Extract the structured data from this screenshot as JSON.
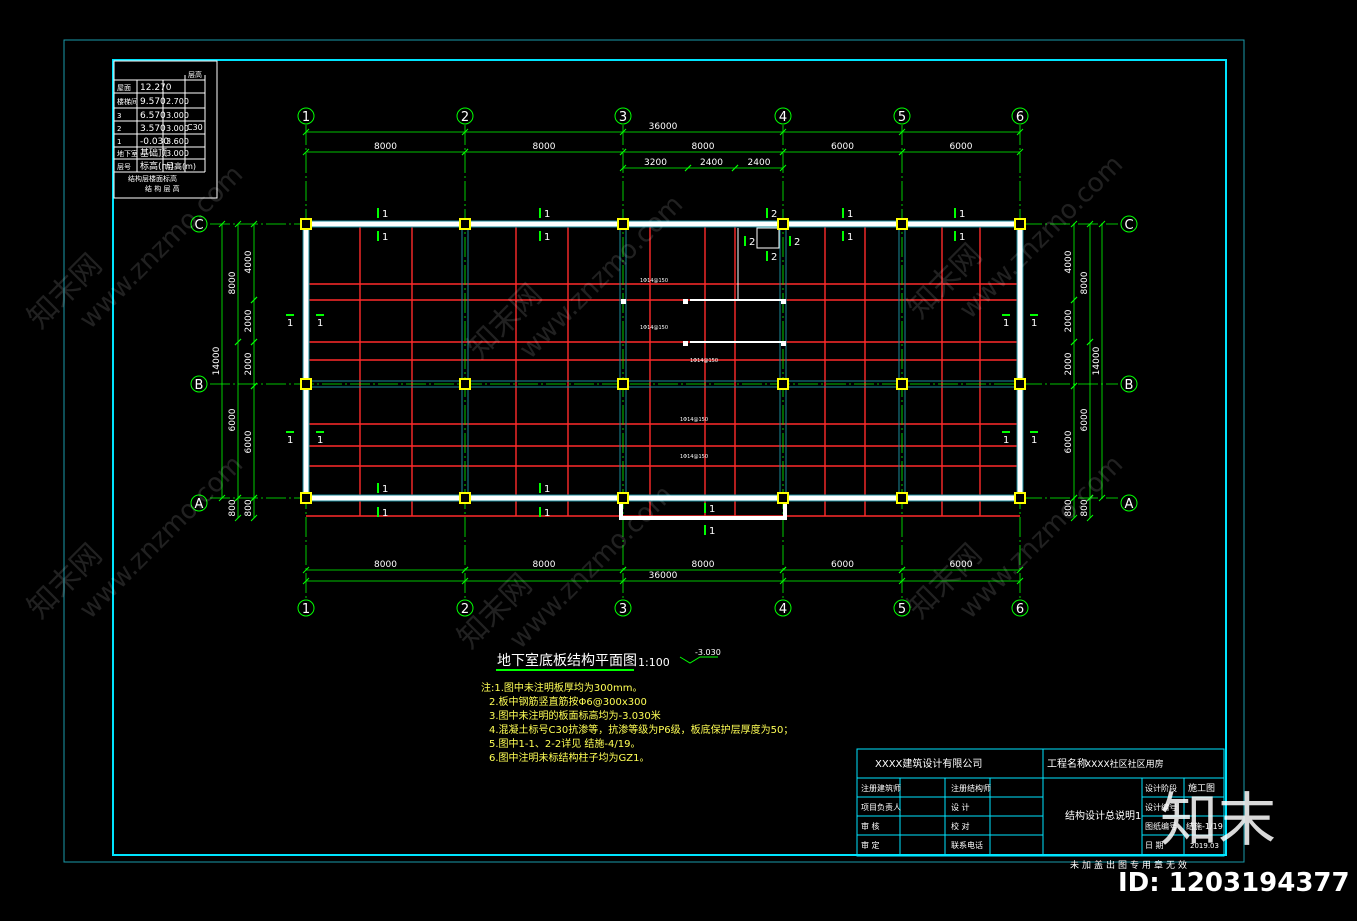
{
  "drawing": {
    "title": "地下室底板结构平面图",
    "scale": "1:100",
    "elevation": "-3.030",
    "axes_numbers": [
      "1",
      "2",
      "3",
      "4",
      "5",
      "6"
    ],
    "axes_letters": [
      "A",
      "B",
      "C"
    ],
    "spans_x_top": [
      "8000",
      "8000",
      "8000",
      "6000",
      "6000"
    ],
    "total_x": "36000",
    "sub_dims": [
      "3200",
      "2400",
      "2400"
    ],
    "spans_y_left_outer": [
      "8000",
      "6000"
    ],
    "spans_y_left_inner": [
      "4000",
      "2000",
      "2000",
      "6000"
    ],
    "total_y": "14000",
    "edge_dim": "800",
    "section_marks": [
      "1",
      "2",
      "1"
    ],
    "rebar_labels": [
      "1Φ14@150",
      "1Φ14@150",
      "1Φ14@150",
      "1Φ14@150",
      "1Φ14@150"
    ]
  },
  "level_table": {
    "header": [
      "",
      "",
      "层高"
    ],
    "rows": [
      [
        "屋面",
        "12.270",
        ""
      ],
      [
        "楼梯间",
        "9.570",
        "2.700"
      ],
      [
        "3",
        "6.570",
        "3.000"
      ],
      [
        "2",
        "3.570",
        "3.000"
      ],
      [
        "1",
        "-0.030",
        "3.600"
      ],
      [
        "地下室",
        "基础顶",
        "3.000"
      ],
      [
        "层号",
        "标高(m)",
        "层高(m)"
      ]
    ],
    "side": "C30",
    "caption1": "结构层楼面标高",
    "caption2": "结 构 层 高"
  },
  "notes": [
    "注:1.图中未注明板厚均为300mm。",
    "2.板中钢筋竖直筋按Φ6@300x300",
    "3.图中未注明的板面标高均为-3.030米",
    "4.混凝土标号C30抗渗等，抗渗等级为P6级，板底保护层厚度为50；",
    "5.图中1-1、2-2详见 结施-4/19。",
    "6.图中注明未标结构柱子均为GZ1。"
  ],
  "title_block": {
    "company": "XXXX建筑设计有限公司",
    "project_label": "工程名称",
    "project_name": "XXXX社区社区用房",
    "drawing_name": "结构设计总说明1",
    "stage_label": "设计阶段",
    "stage": "施工图",
    "design_no_label": "设计编号",
    "sheet_no_label": "图纸编号",
    "sheet_no": "结施-1/19",
    "date_label": "日 期",
    "date": "2019.03",
    "left_rows": [
      "注册建筑师",
      "项目负责人",
      "审 核",
      "审 定"
    ],
    "mid_rows": [
      "注册结构师",
      "设 计",
      "校 对",
      "联系电话"
    ],
    "footer": "未加盖出图专用章无效"
  },
  "watermark": {
    "site": "www.znzmo.com",
    "brand": "知末网",
    "logo": "知末",
    "id": "ID: 1203194377"
  },
  "colors": {
    "frame": "#00e5ff",
    "axis_green": "#00ff00",
    "beam_red": "#ff2a2a",
    "wall": "#ffffff",
    "column": "#ffff00",
    "cyan_dark": "#1a8a9a"
  }
}
